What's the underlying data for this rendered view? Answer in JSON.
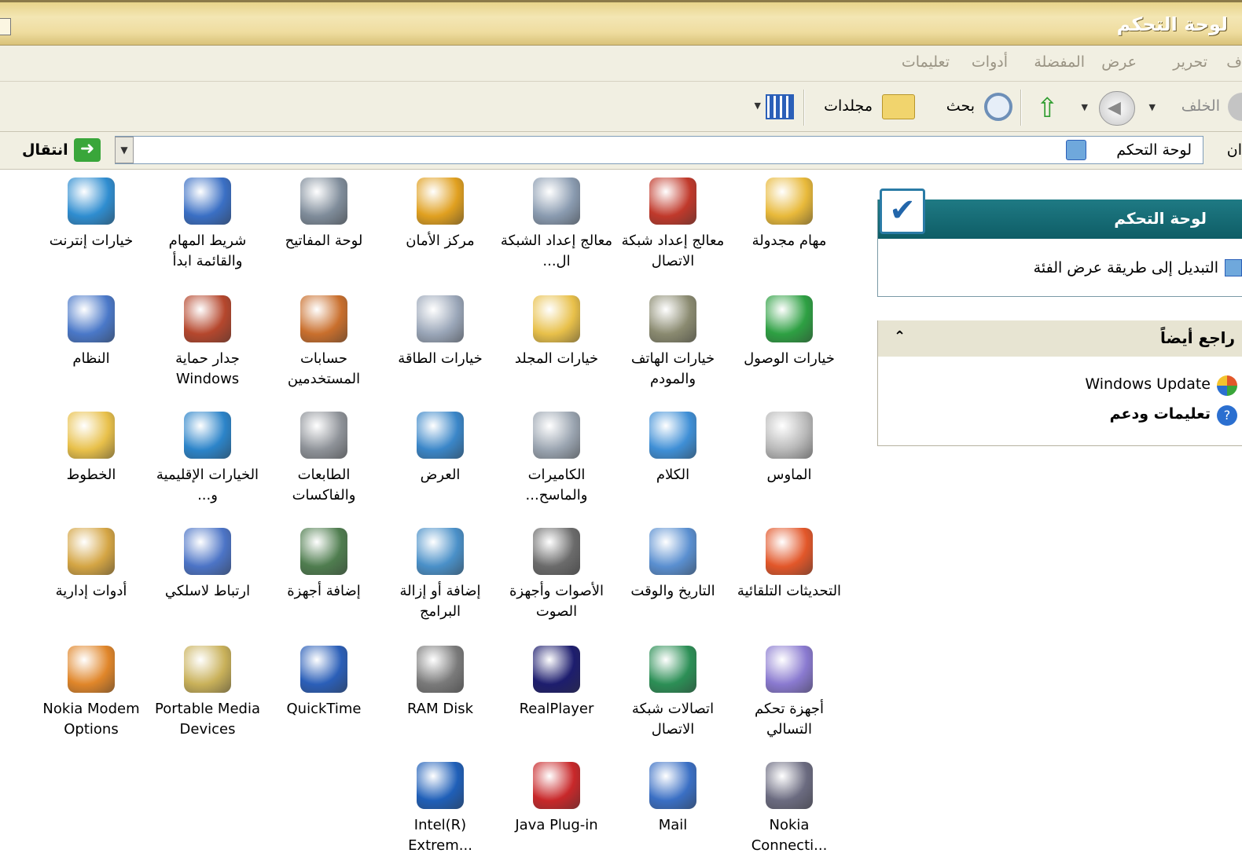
{
  "window": {
    "title": "لوحة التحكم"
  },
  "menu": [
    "ف",
    "تحرير",
    "عرض",
    "المفضلة",
    "أدوات",
    "تعليمات"
  ],
  "toolbar": {
    "back": "الخلف",
    "search": "بحث",
    "folders": "مجلدات"
  },
  "address": {
    "label": "ان",
    "value": "لوحة التحكم",
    "go": "انتقال"
  },
  "tasks": {
    "panel_title": "لوحة التحكم",
    "switch_link": "التبديل إلى طريقة عرض الفئة",
    "see_also_title": "راجع أيضاً",
    "see_also": [
      "Windows Update",
      "تعليمات ودعم"
    ]
  },
  "items": [
    {
      "label": "مهام مجدولة",
      "icon": "scheduled-tasks-icon",
      "color": "#e8b93a"
    },
    {
      "label": "معالج إعداد شبكة الاتصال",
      "icon": "network-setup-wizard-icon",
      "color": "#c0392b"
    },
    {
      "label": "معالج إعداد الشبكة ال...",
      "icon": "wireless-network-setup-icon",
      "color": "#8a9bb0"
    },
    {
      "label": "مركز الأمان",
      "icon": "security-center-shield-icon",
      "color": "#e0a020"
    },
    {
      "label": "لوحة المفاتيح",
      "icon": "keyboard-icon",
      "color": "#7f8c9a"
    },
    {
      "label": "شريط المهام والقائمة ابدأ",
      "icon": "taskbar-start-menu-icon",
      "color": "#3a6fc4"
    },
    {
      "label": "خيارات إنترنت",
      "icon": "internet-options-icon",
      "color": "#2f8dd0"
    },
    {
      "label": "خيارات الوصول",
      "icon": "accessibility-options-icon",
      "color": "#2ea043"
    },
    {
      "label": "خيارات الهاتف والمودم",
      "icon": "phone-modem-icon",
      "color": "#8a8a70"
    },
    {
      "label": "خيارات المجلد",
      "icon": "folder-options-icon",
      "color": "#e8c04a"
    },
    {
      "label": "خيارات الطاقة",
      "icon": "power-options-icon",
      "color": "#9aa6b8"
    },
    {
      "label": "حسابات المستخدمين",
      "icon": "user-accounts-icon",
      "color": "#c96f2d"
    },
    {
      "label": "جدار حماية Windows",
      "icon": "windows-firewall-icon",
      "color": "#b5472d"
    },
    {
      "label": "النظام",
      "icon": "system-icon",
      "color": "#4a78c8"
    },
    {
      "label": "الماوس",
      "icon": "mouse-icon",
      "color": "#b8b8b8"
    },
    {
      "label": "الكلام",
      "icon": "speech-icon",
      "color": "#3f8fd6"
    },
    {
      "label": "الكاميرات والماسح...",
      "icon": "scanners-cameras-icon",
      "color": "#9aa4b0"
    },
    {
      "label": "العرض",
      "icon": "display-icon",
      "color": "#3a86c8"
    },
    {
      "label": "الطابعات والفاكسات",
      "icon": "printers-faxes-icon",
      "color": "#8e9298"
    },
    {
      "label": "الخيارات الإقليمية و...",
      "icon": "regional-options-icon",
      "color": "#2c84c9"
    },
    {
      "label": "الخطوط",
      "icon": "fonts-folder-icon",
      "color": "#e8c04a"
    },
    {
      "label": "التحديثات التلقائية",
      "icon": "automatic-updates-icon",
      "color": "#e2572a"
    },
    {
      "label": "التاريخ والوقت",
      "icon": "date-time-icon",
      "color": "#5a8fd0"
    },
    {
      "label": "الأصوات وأجهزة الصوت",
      "icon": "sounds-speaker-icon",
      "color": "#6b6b6b"
    },
    {
      "label": "إضافة أو إزالة البرامج",
      "icon": "add-remove-programs-icon",
      "color": "#4a90c8"
    },
    {
      "label": "إضافة أجهزة",
      "icon": "add-hardware-icon",
      "color": "#4f7d4f"
    },
    {
      "label": "ارتباط لاسلكي",
      "icon": "wireless-link-icon",
      "color": "#4c74c6"
    },
    {
      "label": "أدوات إدارية",
      "icon": "administrative-tools-icon",
      "color": "#d4a544"
    },
    {
      "label": "أجهزة تحكم التسالي",
      "icon": "game-controllers-icon",
      "color": "#8a7ad0"
    },
    {
      "label": "اتصالات شبكة الاتصال",
      "icon": "network-connections-icon",
      "color": "#2c8f56"
    },
    {
      "label": "RealPlayer",
      "icon": "realplayer-icon",
      "color": "#1d1d6e"
    },
    {
      "label": "RAM Disk",
      "icon": "ram-disk-chip-icon",
      "color": "#7a7a7a"
    },
    {
      "label": "QuickTime",
      "icon": "quicktime-icon",
      "color": "#2b5fb8"
    },
    {
      "label": "Portable Media Devices",
      "icon": "portable-media-devices-icon",
      "color": "#c9b15a"
    },
    {
      "label": "Nokia Modem Options",
      "icon": "nokia-modem-icon",
      "color": "#e0862a"
    },
    {
      "label": "Nokia Connecti...",
      "icon": "nokia-connectivity-icon",
      "color": "#6b6b80"
    },
    {
      "label": "Mail",
      "icon": "mail-icon",
      "color": "#3a6fc4"
    },
    {
      "label": "Java Plug-in",
      "icon": "java-coffee-icon",
      "color": "#c8282a"
    },
    {
      "label": "Intel(R) Extrem...",
      "icon": "intel-graphics-icon",
      "color": "#1f5fb8"
    }
  ]
}
